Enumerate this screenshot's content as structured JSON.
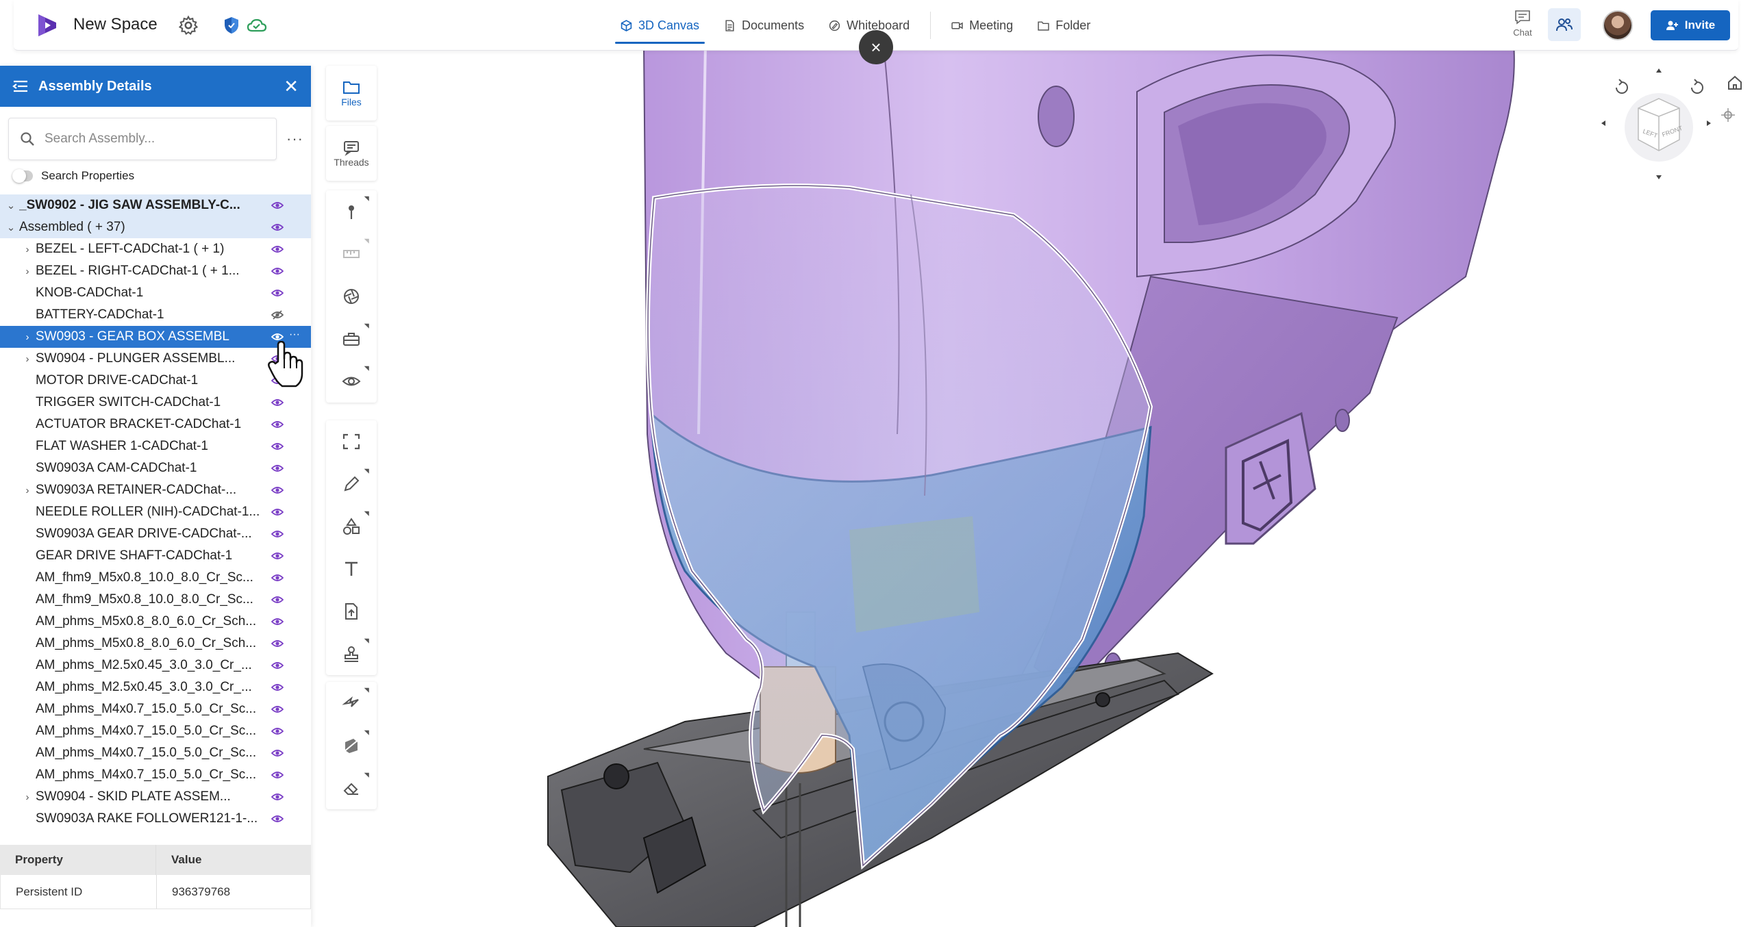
{
  "topbar": {
    "space_name": "New Space",
    "tabs": [
      {
        "label": "3D Canvas",
        "active": true
      },
      {
        "label": "Documents",
        "active": false
      },
      {
        "label": "Whiteboard",
        "active": false
      },
      {
        "label": "Meeting",
        "active": false
      },
      {
        "label": "Folder",
        "active": false
      }
    ],
    "chat_label": "Chat",
    "invite_label": "Invite"
  },
  "panel": {
    "title": "Assembly Details",
    "search_placeholder": "Search Assembly...",
    "toggle_label": "Search Properties",
    "tree": [
      {
        "label": "_SW0902 - JIG SAW ASSEMBLY-C...",
        "indent": 0,
        "chevron": "down",
        "eye": "visible",
        "style": "root"
      },
      {
        "label": "Assembled ( + 37)",
        "indent": 1,
        "chevron": "down",
        "eye": "visible",
        "style": "hl"
      },
      {
        "label": "BEZEL - LEFT-CADChat-1 ( + 1)",
        "indent": 2,
        "chevron": "right",
        "eye": "visible"
      },
      {
        "label": "BEZEL - RIGHT-CADChat-1 ( + 1...",
        "indent": 2,
        "chevron": "right",
        "eye": "visible"
      },
      {
        "label": "KNOB-CADChat-1",
        "indent": 1,
        "chevron": "",
        "eye": "visible"
      },
      {
        "label": "BATTERY-CADChat-1",
        "indent": 1,
        "chevron": "",
        "eye": "hidden"
      },
      {
        "label": "SW0903 - GEAR BOX ASSEMBL",
        "indent": 2,
        "chevron": "right",
        "eye": "visible",
        "style": "sel"
      },
      {
        "label": "SW0904 - PLUNGER ASSEMBL...",
        "indent": 2,
        "chevron": "right",
        "eye": "visible"
      },
      {
        "label": "MOTOR DRIVE-CADChat-1",
        "indent": 1,
        "chevron": "",
        "eye": "visible"
      },
      {
        "label": "TRIGGER SWITCH-CADChat-1",
        "indent": 1,
        "chevron": "",
        "eye": "visible"
      },
      {
        "label": "ACTUATOR BRACKET-CADChat-1",
        "indent": 1,
        "chevron": "",
        "eye": "visible"
      },
      {
        "label": "FLAT WASHER 1-CADChat-1",
        "indent": 1,
        "chevron": "",
        "eye": "visible"
      },
      {
        "label": "SW0903A CAM-CADChat-1",
        "indent": 1,
        "chevron": "",
        "eye": "visible"
      },
      {
        "label": "SW0903A RETAINER-CADChat-...",
        "indent": 2,
        "chevron": "right",
        "eye": "visible"
      },
      {
        "label": "NEEDLE ROLLER (NIH)-CADChat-1...",
        "indent": 1,
        "chevron": "",
        "eye": "visible"
      },
      {
        "label": "SW0903A GEAR DRIVE-CADChat-...",
        "indent": 1,
        "chevron": "",
        "eye": "visible"
      },
      {
        "label": "GEAR DRIVE SHAFT-CADChat-1",
        "indent": 1,
        "chevron": "",
        "eye": "visible"
      },
      {
        "label": "AM_fhm9_M5x0.8_10.0_8.0_Cr_Sc...",
        "indent": 1,
        "chevron": "",
        "eye": "visible"
      },
      {
        "label": "AM_fhm9_M5x0.8_10.0_8.0_Cr_Sc...",
        "indent": 1,
        "chevron": "",
        "eye": "visible"
      },
      {
        "label": "AM_phms_M5x0.8_8.0_6.0_Cr_Sch...",
        "indent": 1,
        "chevron": "",
        "eye": "visible"
      },
      {
        "label": "AM_phms_M5x0.8_8.0_6.0_Cr_Sch...",
        "indent": 1,
        "chevron": "",
        "eye": "visible"
      },
      {
        "label": "AM_phms_M2.5x0.45_3.0_3.0_Cr_...",
        "indent": 1,
        "chevron": "",
        "eye": "visible"
      },
      {
        "label": "AM_phms_M2.5x0.45_3.0_3.0_Cr_...",
        "indent": 1,
        "chevron": "",
        "eye": "visible"
      },
      {
        "label": "AM_phms_M4x0.7_15.0_5.0_Cr_Sc...",
        "indent": 1,
        "chevron": "",
        "eye": "visible"
      },
      {
        "label": "AM_phms_M4x0.7_15.0_5.0_Cr_Sc...",
        "indent": 1,
        "chevron": "",
        "eye": "visible"
      },
      {
        "label": "AM_phms_M4x0.7_15.0_5.0_Cr_Sc...",
        "indent": 1,
        "chevron": "",
        "eye": "visible"
      },
      {
        "label": "AM_phms_M4x0.7_15.0_5.0_Cr_Sc...",
        "indent": 1,
        "chevron": "",
        "eye": "visible"
      },
      {
        "label": "SW0904 - SKID PLATE ASSEM...",
        "indent": 2,
        "chevron": "right",
        "eye": "visible"
      },
      {
        "label": "SW0903A RAKE FOLLOWER121-1-...",
        "indent": 1,
        "chevron": "",
        "eye": "visible"
      }
    ],
    "properties": {
      "headers": [
        "Property",
        "Value"
      ],
      "rows": [
        {
          "property": "Persistent ID",
          "value": "936379768"
        }
      ]
    }
  },
  "toolbar": {
    "files_label": "Files",
    "threads_label": "Threads"
  },
  "viewcube": {
    "left_label": "LEFT",
    "front_label": "FRONT"
  },
  "colors": {
    "accent": "#1565c0",
    "panel_header": "#1e6fc8",
    "selected_row": "#2b76cf",
    "eye": "#7b3fc6",
    "body": "#c9a9e8",
    "gearbox": "#6f9fd3"
  }
}
